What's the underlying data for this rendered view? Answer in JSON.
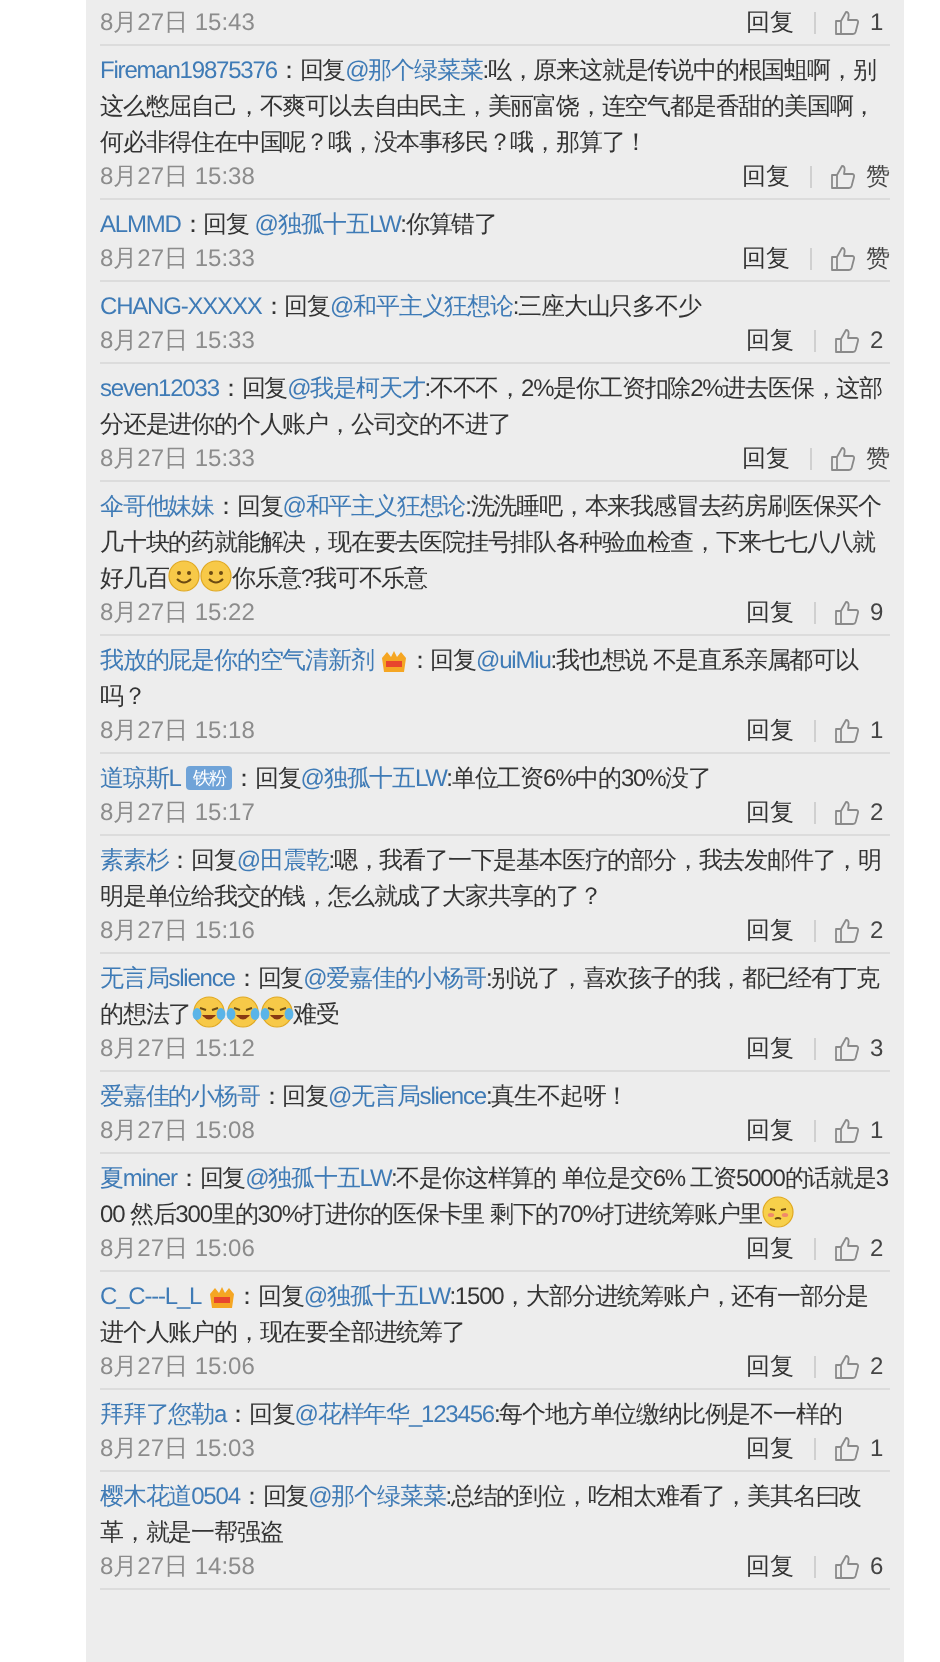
{
  "comments": [
    {
      "date": "8月27日 15:43",
      "reply": "回复",
      "likes": "1"
    },
    {
      "user": "Fireman19875376",
      "prefix": "：回复",
      "mention": "@那个绿菜菜",
      "body": [
        {
          "kind": "text",
          "text": ":吆，原来这就是传说中的根国蛆啊，别这么憋屈自己，不爽可以去自由民主，美丽富饶，连空气都是香甜的美国啊，何必非得住在中国呢？哦，没本事移民？哦，那算了！"
        }
      ],
      "date": "8月27日 15:38",
      "reply": "回复",
      "likes": "赞"
    },
    {
      "user": "ALMMD",
      "prefix": "：回复 ",
      "mention": "@独孤十五LW",
      "body": [
        {
          "kind": "text",
          "text": ":你算错了"
        }
      ],
      "date": "8月27日 15:33",
      "reply": "回复",
      "likes": "赞"
    },
    {
      "user": "CHANG-XXXXX",
      "prefix": "：回复",
      "mention": "@和平主义狂想论",
      "body": [
        {
          "kind": "text",
          "text": ":三座大山只多不少"
        }
      ],
      "date": "8月27日 15:33",
      "reply": "回复",
      "likes": "2"
    },
    {
      "user": "seven12033",
      "prefix": "：回复",
      "mention": "@我是柯天才",
      "body": [
        {
          "kind": "text",
          "text": ":不不不，2%是你工资扣除2%进去医保，这部分还是进你的个人账户，公司交的不进了"
        }
      ],
      "date": "8月27日 15:33",
      "reply": "回复",
      "likes": "赞"
    },
    {
      "user": "伞哥他妹妹",
      "prefix": "：回复",
      "mention": "@和平主义狂想论",
      "body": [
        {
          "kind": "text",
          "text": ":洗洗睡吧，本来我感冒去药房刷医保买个几十块的药就能解决，现在要去医院挂号排队各种验血检查，下来七七八八就好几百"
        },
        {
          "kind": "smile"
        },
        {
          "kind": "smile"
        },
        {
          "kind": "text",
          "text": "你乐意?我可不乐意"
        }
      ],
      "date": "8月27日 15:22",
      "reply": "回复",
      "likes": "9"
    },
    {
      "user": "我放的屁是你的空气清新剂",
      "badge": {
        "kind": "medal"
      },
      "prefix": "：回复",
      "mention": "@uiMiu",
      "body": [
        {
          "kind": "text",
          "text": ":我也想说 不是直系亲属都可以吗？"
        }
      ],
      "date": "8月27日 15:18",
      "reply": "回复",
      "likes": "1"
    },
    {
      "user": "道琼斯L",
      "badge": {
        "kind": "label",
        "text": "铁粉"
      },
      "prefix": "：回复",
      "mention": "@独孤十五LW",
      "body": [
        {
          "kind": "text",
          "text": ":单位工资6%中的30%没了"
        }
      ],
      "date": "8月27日 15:17",
      "reply": "回复",
      "likes": "2"
    },
    {
      "user": "素素杉",
      "prefix": "：回复",
      "mention": "@田震乾",
      "body": [
        {
          "kind": "text",
          "text": ":嗯，我看了一下是基本医疗的部分，我去发邮件了，明明是单位给我交的钱，怎么就成了大家共享的了？"
        }
      ],
      "date": "8月27日 15:16",
      "reply": "回复",
      "likes": "2"
    },
    {
      "user": "无言局slience",
      "prefix": "：回复",
      "mention": "@爱嘉佳的小杨哥",
      "body": [
        {
          "kind": "text",
          "text": ":别说了，喜欢孩子的我，都已经有丁克的想法了"
        },
        {
          "kind": "tears"
        },
        {
          "kind": "tears"
        },
        {
          "kind": "tears"
        },
        {
          "kind": "text",
          "text": "难受"
        }
      ],
      "date": "8月27日 15:12",
      "reply": "回复",
      "likes": "3"
    },
    {
      "user": "爱嘉佳的小杨哥",
      "prefix": "：回复",
      "mention": "@无言局slience",
      "body": [
        {
          "kind": "text",
          "text": ":真生不起呀！"
        }
      ],
      "date": "8月27日 15:08",
      "reply": "回复",
      "likes": "1"
    },
    {
      "user": "夏miner",
      "prefix": "：回复",
      "mention": "@独孤十五LW",
      "body": [
        {
          "kind": "text",
          "text": ":不是你这样算的 单位是交6% 工资5000的话就是300  然后300里的30%打进你的医保卡里 剩下的70%打进统筹账户里"
        },
        {
          "kind": "blush"
        }
      ],
      "date": "8月27日 15:06",
      "reply": "回复",
      "likes": "2"
    },
    {
      "user": "C_C---L_L",
      "badge": {
        "kind": "medal"
      },
      "prefix": "：回复",
      "mention": "@独孤十五LW",
      "body": [
        {
          "kind": "text",
          "text": ":1500，大部分进统筹账户，还有一部分是进个人账户的，现在要全部进统筹了"
        }
      ],
      "date": "8月27日 15:06",
      "reply": "回复",
      "likes": "2"
    },
    {
      "user": "拜拜了您勒a",
      "prefix": "：回复",
      "mention": "@花样年华_123456",
      "body": [
        {
          "kind": "text",
          "text": ":每个地方单位缴纳比例是不一样的"
        }
      ],
      "date": "8月27日 15:03",
      "reply": "回复",
      "likes": "1"
    },
    {
      "user": "樱木花道0504",
      "prefix": "：回复",
      "mention": "@那个绿菜菜",
      "body": [
        {
          "kind": "text",
          "text": ":总结的到位，吃相太难看了，美其名曰改革，就是一帮强盗"
        }
      ],
      "date": "8月27日 14:58",
      "reply": "回复",
      "likes": "6"
    }
  ]
}
